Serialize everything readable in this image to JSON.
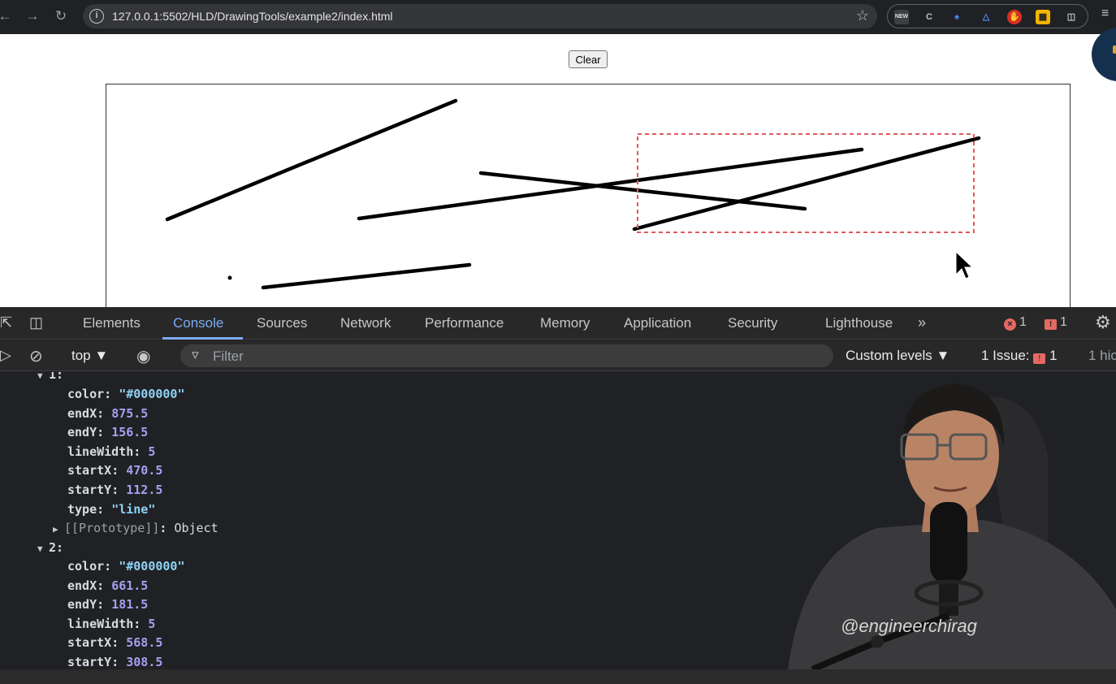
{
  "browser": {
    "url": "127.0.0.1:5502/HLD/DrawingTools/example2/index.html"
  },
  "page": {
    "clear_label": "Clear"
  },
  "devtools": {
    "tabs": [
      "Elements",
      "Console",
      "Sources",
      "Network",
      "Performance",
      "Memory",
      "Application",
      "Security",
      "Lighthouse"
    ],
    "active_tab": "Console",
    "error_count": "1",
    "warning_count": "1",
    "context": "top",
    "filter_placeholder": "Filter",
    "levels": "Custom levels",
    "issues_label": "1 Issue:",
    "issues_count": "1",
    "hidden_label": "1 hic"
  },
  "console": {
    "obj1_header": "1:",
    "obj1": [
      {
        "key": "color",
        "value": "\"#000000\"",
        "kind": "str"
      },
      {
        "key": "endX",
        "value": "875.5",
        "kind": "num"
      },
      {
        "key": "endY",
        "value": "156.5",
        "kind": "num"
      },
      {
        "key": "lineWidth",
        "value": "5",
        "kind": "num"
      },
      {
        "key": "startX",
        "value": "470.5",
        "kind": "num"
      },
      {
        "key": "startY",
        "value": "112.5",
        "kind": "num"
      },
      {
        "key": "type",
        "value": "\"line\"",
        "kind": "str"
      }
    ],
    "prototype_label": "[[Prototype]]",
    "prototype_value": "Object",
    "obj2_header": "2:",
    "obj2": [
      {
        "key": "color",
        "value": "\"#000000\"",
        "kind": "str"
      },
      {
        "key": "endX",
        "value": "661.5",
        "kind": "num"
      },
      {
        "key": "endY",
        "value": "181.5",
        "kind": "num"
      },
      {
        "key": "lineWidth",
        "value": "5",
        "kind": "num"
      },
      {
        "key": "startX",
        "value": "568.5",
        "kind": "num"
      },
      {
        "key": "startY",
        "value": "308.5",
        "kind": "num"
      }
    ]
  },
  "webcam": {
    "shirt_handle": "@engineerchirag"
  },
  "colors": {
    "accent": "#7cacf8",
    "error": "#e46962",
    "selection": "#e05a5a"
  }
}
